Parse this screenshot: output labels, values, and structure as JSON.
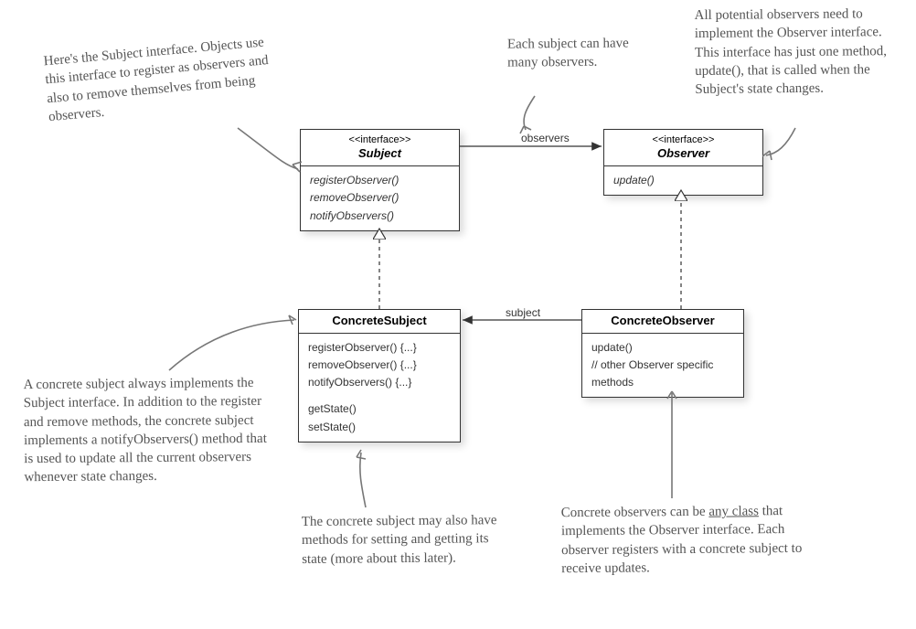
{
  "boxes": {
    "subject": {
      "stereo": "<<interface>>",
      "name": "Subject",
      "methods": [
        "registerObserver()",
        "removeObserver()",
        "notifyObservers()"
      ]
    },
    "observer": {
      "stereo": "<<interface>>",
      "name": "Observer",
      "methods": [
        "update()"
      ]
    },
    "concreteSubject": {
      "name": "ConcreteSubject",
      "methods1": [
        "registerObserver() {...}",
        "removeObserver() {...}",
        "notifyObservers() {...}"
      ],
      "methods2": [
        "getState()",
        "setState()"
      ]
    },
    "concreteObserver": {
      "name": "ConcreteObserver",
      "methods": [
        "update()",
        "// other Observer specific",
        "methods"
      ]
    }
  },
  "relations": {
    "observers": "observers",
    "subject": "subject"
  },
  "annotations": {
    "subjectNote": "Here's the Subject interface. Objects use this interface to register as observers and also to remove themselves from being observers.",
    "manyObservers": "Each subject can have many observers.",
    "observerNote": "All potential observers need to implement the Observer interface. This interface has just one method, update(), that is called when the Subject's state changes.",
    "concreteSubjectNote": "A concrete subject always implements the Subject interface. In addition to the register and remove methods, the concrete subject implements a notifyObservers() method that is used to update all the current observers whenever state changes.",
    "stateNote": "The concrete subject may also have methods for setting and getting its state (more about this later).",
    "concreteObserverNote_a": "Concrete observers can be ",
    "concreteObserverNote_b": "any class",
    "concreteObserverNote_c": " that implements the Observer interface. Each observer registers with a concrete subject to receive updates."
  }
}
